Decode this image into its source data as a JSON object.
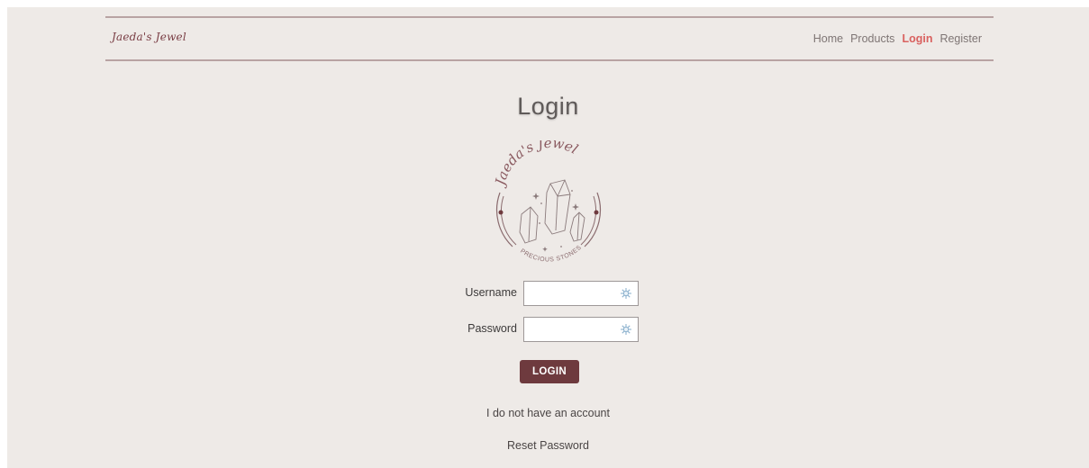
{
  "brand": {
    "name": "Jaeda's Jewel"
  },
  "nav": {
    "items": [
      {
        "label": "Home"
      },
      {
        "label": "Products"
      },
      {
        "label": "Login"
      },
      {
        "label": "Register"
      }
    ],
    "active": "Login"
  },
  "page_title": "Login",
  "logo": {
    "top_text": "Jaeda's Jewel",
    "bottom_text": "PRECIOUS STONES"
  },
  "form": {
    "username_label": "Username",
    "username_value": "",
    "password_label": "Password",
    "password_value": "",
    "submit_label": "LOGIN"
  },
  "links": {
    "no_account": "I do not have an account",
    "reset_password": "Reset Password"
  },
  "colors": {
    "background": "#eeeae7",
    "accent": "#d9615f",
    "button": "#6e3a3e",
    "divider": "#b8a3a3"
  }
}
